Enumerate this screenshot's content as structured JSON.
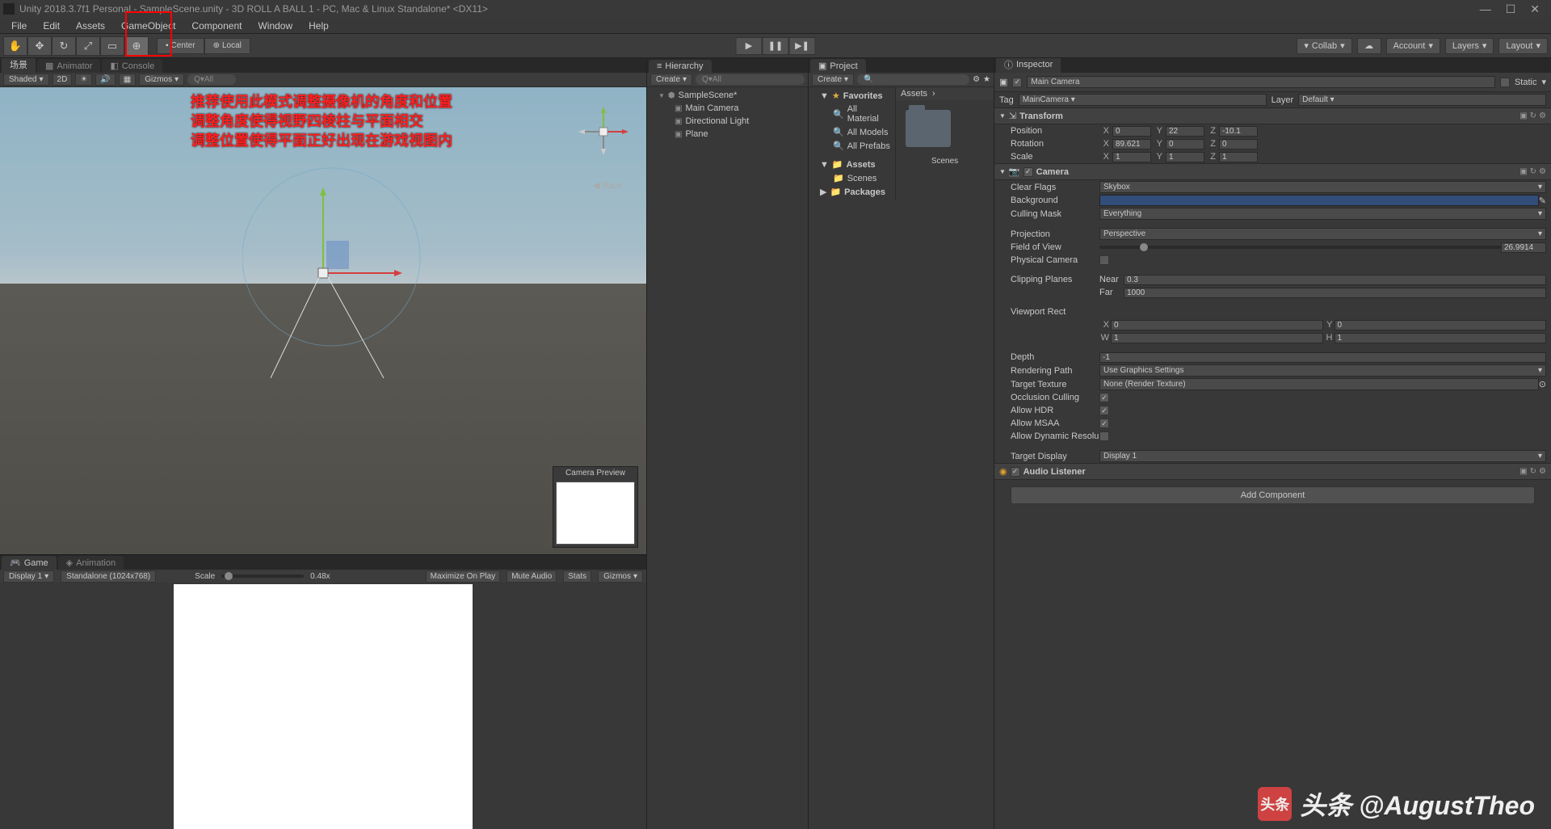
{
  "titlebar": {
    "text": "Unity 2018.3.7f1 Personal - SampleScene.unity - 3D ROLL A BALL 1 - PC, Mac & Linux Standalone* <DX11>"
  },
  "menubar": [
    "File",
    "Edit",
    "Assets",
    "GameObject",
    "Component",
    "Window",
    "Help"
  ],
  "toolbar": {
    "pivot": "Center",
    "handle": "Local",
    "collab": "Collab",
    "account": "Account",
    "layers": "Layers",
    "layout": "Layout"
  },
  "scene_toolbar": {
    "tab1": "场景",
    "tab2": "Animator",
    "tab3": "Console",
    "shading": "Shaded",
    "mode2d": "2D",
    "gizmos": "Gizmos",
    "search": "Q▾All"
  },
  "annotation": {
    "line1": "推荐使用此模式调整摄像机的角度和位置",
    "line2": "调整角度使得视野四棱柱与平面相交",
    "line3": "调整位置使得平面正好出现在游戏视图内"
  },
  "camera_preview": "Camera Preview",
  "back_label": "◀ Back",
  "game": {
    "tab1": "Game",
    "tab2": "Animation",
    "display": "Display 1",
    "aspect": "Standalone (1024x768)",
    "scale_label": "Scale",
    "scale_value": "0.48x",
    "maximize": "Maximize On Play",
    "mute": "Mute Audio",
    "stats": "Stats",
    "gizmos": "Gizmos"
  },
  "hierarchy": {
    "tab": "Hierarchy",
    "create": "Create",
    "search": "Q▾All",
    "scene": "SampleScene*",
    "items": [
      "Main Camera",
      "Directional Light",
      "Plane"
    ]
  },
  "project": {
    "tab": "Project",
    "create": "Create",
    "favorites": "Favorites",
    "fav_items": [
      "All Material",
      "All Models",
      "All Prefabs"
    ],
    "assets": "Assets",
    "scenes": "Scenes",
    "packages": "Packages",
    "breadcrumb": "Assets",
    "folder_name": "Scenes"
  },
  "inspector": {
    "tab": "Inspector",
    "name": "Main Camera",
    "static": "Static",
    "tag_label": "Tag",
    "tag_value": "MainCamera",
    "layer_label": "Layer",
    "layer_value": "Default",
    "transform": {
      "title": "Transform",
      "position_label": "Position",
      "position": {
        "x": "0",
        "y": "22",
        "z": "-10.1"
      },
      "rotation_label": "Rotation",
      "rotation": {
        "x": "89.621",
        "y": "0",
        "z": "0"
      },
      "scale_label": "Scale",
      "scale": {
        "x": "1",
        "y": "1",
        "z": "1"
      }
    },
    "camera": {
      "title": "Camera",
      "clear_flags_label": "Clear Flags",
      "clear_flags": "Skybox",
      "background_label": "Background",
      "culling_label": "Culling Mask",
      "culling": "Everything",
      "projection_label": "Projection",
      "projection": "Perspective",
      "fov_label": "Field of View",
      "fov": "26.9914",
      "physical_label": "Physical Camera",
      "clipping_label": "Clipping Planes",
      "near_label": "Near",
      "near": "0.3",
      "far_label": "Far",
      "far": "1000",
      "viewport_label": "Viewport Rect",
      "vx": "0",
      "vy": "0",
      "vw": "1",
      "vh": "1",
      "depth_label": "Depth",
      "depth": "-1",
      "rendering_label": "Rendering Path",
      "rendering": "Use Graphics Settings",
      "texture_label": "Target Texture",
      "texture": "None (Render Texture)",
      "occlusion_label": "Occlusion Culling",
      "hdr_label": "Allow HDR",
      "msaa_label": "Allow MSAA",
      "dynres_label": "Allow Dynamic Resolu",
      "display_label": "Target Display",
      "display": "Display 1"
    },
    "audio_listener": "Audio Listener",
    "add_component": "Add Component"
  },
  "watermark": "头条 @AugustTheo"
}
